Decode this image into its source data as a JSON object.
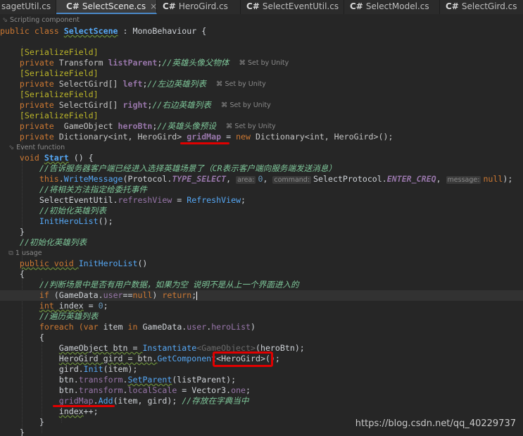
{
  "tabs": [
    {
      "icon": "",
      "label": "sagetUtil.cs",
      "active": false
    },
    {
      "icon": "C#",
      "label": "SelectScene.cs",
      "active": true,
      "close": "×"
    },
    {
      "icon": "C#",
      "label": "HeroGird.cs",
      "active": false
    },
    {
      "icon": "C#",
      "label": "SelectEventUtil.cs",
      "active": false
    },
    {
      "icon": "C#",
      "label": "SelectModel.cs",
      "active": false
    },
    {
      "icon": "C#",
      "label": "SelectGird.cs",
      "active": false
    }
  ],
  "hints": {
    "scripting_component": "Scripting component",
    "set_by_unity": "Set by Unity",
    "event_function": "Event function",
    "usages": "1 usage"
  },
  "code": {
    "class_kw": "public class ",
    "class_name": "SelectScene",
    "class_base": " : MonoBehaviour {",
    "serialize_field": "[SerializeField]",
    "private": "private ",
    "transform": "Transform ",
    "list_parent": "listParent",
    "cm_list_parent": "//英雄头像父物体",
    "select_gird_arr": "SelectGird[] ",
    "left": "left",
    "cm_left": "//左边英雄列表",
    "right": "right",
    "cm_right": "//右边英雄列表",
    "gameobject": " GameObject ",
    "hero_btn": "heroBtn",
    "cm_hero_btn": "//英雄头像预设",
    "dict_decl_a": "Dictionary<int, HeroGird> ",
    "grid_map": "gridMap",
    "dict_decl_b": " = ",
    "new_kw": "new ",
    "dict_decl_c": "Dictionary<int, HeroGird>();",
    "void_kw": "void ",
    "start": "Start",
    "start_tail": " () {",
    "cm_start_1": "//告诉服务器客户端已经进入选择英雄场景了（CR表示客户端向服务端发送消息）",
    "this_kw": "this",
    "write_message": "WriteMessage",
    "wm_a": "(Protocol.",
    "type_select": "TYPE_SELECT",
    "ph_area": "area:",
    "zero": "0",
    "ph_command": "command:",
    "select_protocol": "SelectProtocol.",
    "enter_creq": "ENTER_CREQ",
    "ph_message": "message:",
    "null_kw": "null",
    "wm_end": ");",
    "cm_start_2": "//将相关方法指定给委托事件",
    "seu": "SelectEventUtil.",
    "refresh_view": "refreshView",
    "rv_eq": " = ",
    "refresh_view_fn": "RefreshView",
    "semi": ";",
    "cm_start_3": "//初始化英雄列表",
    "init_call": "InitHeroList",
    "call_end": "();",
    "close_brace": "}",
    "open_brace": "{",
    "cm_init": "//初始化英雄列表",
    "public_void": "public void ",
    "init_hero_list": "InitHeroList",
    "parens": "()",
    "cm_check": "//判断场景中是否有用户数据，如果为空 说明不是从上一个界面进入的",
    "if_kw": "if ",
    "gd_user": "(GameData.",
    "user": "user",
    "eq_null": "==",
    "return_kw": " return",
    "int_kw": "int ",
    "index": "index",
    "eq_zero": " = ",
    "cm_loop": "//遍历英雄列表",
    "foreach_kw": "foreach ",
    "var_kw": "(var ",
    "item_in": "item ",
    "in_kw": "in ",
    "gd": "GameData.",
    "hero_list": "heroList",
    "rparen": ")",
    "go_btn": "GameObject btn = ",
    "instantiate": "Instantiate",
    "gen_go": "<GameObject>",
    "hero_btn_arg": "(heroBtn);",
    "herogird_gird": "HeroGird gird = btn.",
    "get_component": "GetComponent",
    "gen_herogird": "<HeroGird>",
    "gc_end": "();",
    "gird_init_a": "gird.",
    "init_fn": "Init",
    "gird_init_b": "(item);",
    "btn_transform": "btn.",
    "transform_prop": "transform",
    "dot": ".",
    "set_parent": "SetParent",
    "sp_args": "(listParent);",
    "local_scale": "localScale",
    "ls_tail": " = Vector3.",
    "one": "one",
    "grid_map_use": "gridMap",
    "add_fn": "Add",
    "add_args": "(item, gird); ",
    "cm_store": "//存放在字典当中",
    "index_inc": "index",
    "plus_plus": "++;"
  },
  "watermark": "https://blog.csdn.net/qq_40229737",
  "colors": {
    "annotation_red": "#e00000",
    "accent_tab": "#4a88c7"
  }
}
